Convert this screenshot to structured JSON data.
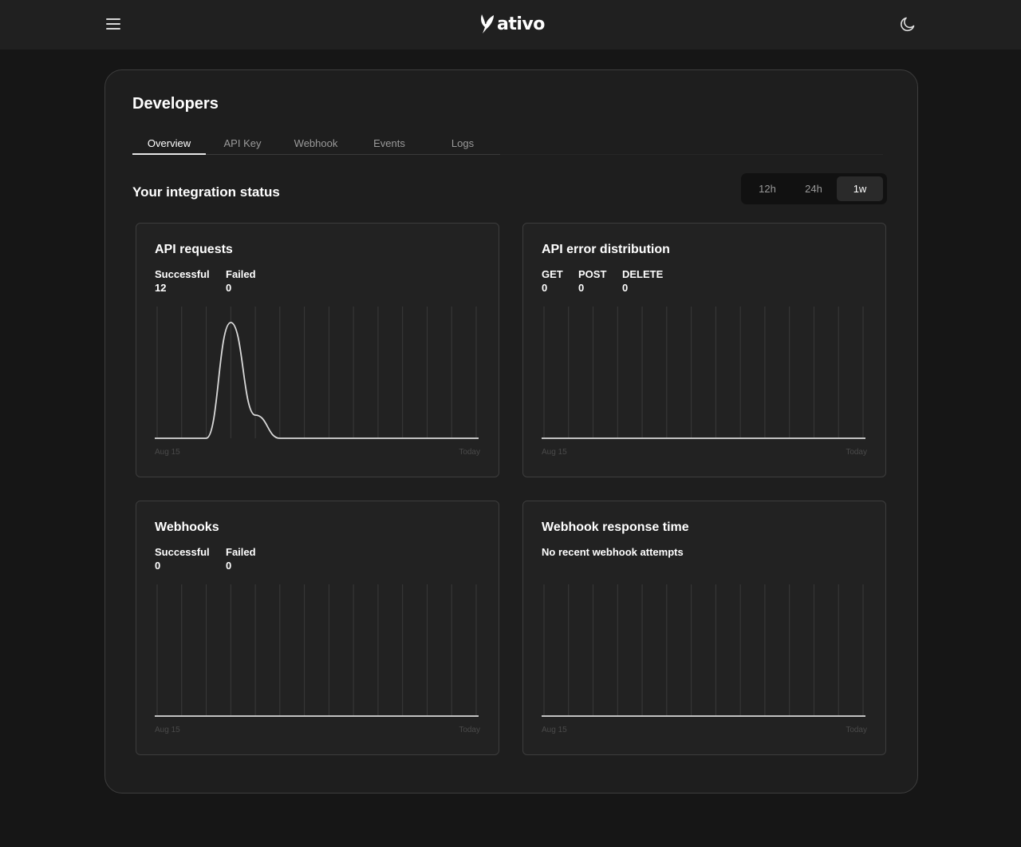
{
  "app": {
    "logo_text": "ativo",
    "icons": {
      "menu": "hamburger-menu-icon",
      "logo": "logo-mark-icon",
      "theme": "moon-icon"
    }
  },
  "page": {
    "title": "Developers",
    "tabs": [
      {
        "label": "Overview",
        "active": true
      },
      {
        "label": "API Key",
        "active": false
      },
      {
        "label": "Webhook",
        "active": false
      },
      {
        "label": "Events",
        "active": false
      },
      {
        "label": "Logs",
        "active": false
      }
    ]
  },
  "status": {
    "title": "Your integration status",
    "ranges": [
      {
        "label": "12h",
        "active": false
      },
      {
        "label": "24h",
        "active": false
      },
      {
        "label": "1w",
        "active": true
      }
    ]
  },
  "cards": {
    "api_requests": {
      "title": "API requests",
      "stats": [
        {
          "label": "Successful",
          "value": "12"
        },
        {
          "label": "Failed",
          "value": "0"
        }
      ],
      "axis_start": "Aug 15",
      "axis_end": "Today"
    },
    "api_errors": {
      "title": "API error distribution",
      "stats": [
        {
          "label": "GET",
          "value": "0"
        },
        {
          "label": "POST",
          "value": "0"
        },
        {
          "label": "DELETE",
          "value": "0"
        }
      ],
      "axis_start": "Aug 15",
      "axis_end": "Today"
    },
    "webhooks": {
      "title": "Webhooks",
      "stats": [
        {
          "label": "Successful",
          "value": "0"
        },
        {
          "label": "Failed",
          "value": "0"
        }
      ],
      "axis_start": "Aug 15",
      "axis_end": "Today"
    },
    "webhook_response": {
      "title": "Webhook response time",
      "note": "No recent webhook attempts",
      "axis_start": "Aug 15",
      "axis_end": "Today"
    }
  },
  "colors": {
    "background": "#161616",
    "panel": "#1e1e1e",
    "card": "#222222",
    "border": "#3d3d3d",
    "line": "#d9d9d9",
    "grid": "#3a3a3a"
  },
  "chart_data": [
    {
      "type": "line",
      "name": "API requests",
      "x": [
        0,
        1,
        2,
        3,
        4,
        5,
        6,
        7,
        8,
        9,
        10,
        11,
        12,
        13
      ],
      "series": [
        {
          "values": [
            0,
            0,
            0,
            10,
            2,
            0,
            0,
            0,
            0,
            0,
            0,
            0,
            0,
            0
          ]
        }
      ],
      "ylim": [
        0,
        10
      ],
      "grid": true
    },
    {
      "type": "line",
      "name": "API error distribution",
      "x": [
        0,
        1,
        2,
        3,
        4,
        5,
        6,
        7,
        8,
        9,
        10,
        11,
        12,
        13
      ],
      "series": [
        {
          "values": [
            0,
            0,
            0,
            0,
            0,
            0,
            0,
            0,
            0,
            0,
            0,
            0,
            0,
            0
          ]
        }
      ],
      "grid": true
    },
    {
      "type": "line",
      "name": "Webhooks",
      "x": [
        0,
        1,
        2,
        3,
        4,
        5,
        6,
        7,
        8,
        9,
        10,
        11,
        12,
        13
      ],
      "series": [
        {
          "values": [
            0,
            0,
            0,
            0,
            0,
            0,
            0,
            0,
            0,
            0,
            0,
            0,
            0,
            0
          ]
        }
      ],
      "grid": true
    },
    {
      "type": "line",
      "name": "Webhook response time",
      "x": [
        0,
        1,
        2,
        3,
        4,
        5,
        6,
        7,
        8,
        9,
        10,
        11,
        12,
        13
      ],
      "series": [
        {
          "values": [
            0,
            0,
            0,
            0,
            0,
            0,
            0,
            0,
            0,
            0,
            0,
            0,
            0,
            0
          ]
        }
      ],
      "grid": true
    }
  ]
}
